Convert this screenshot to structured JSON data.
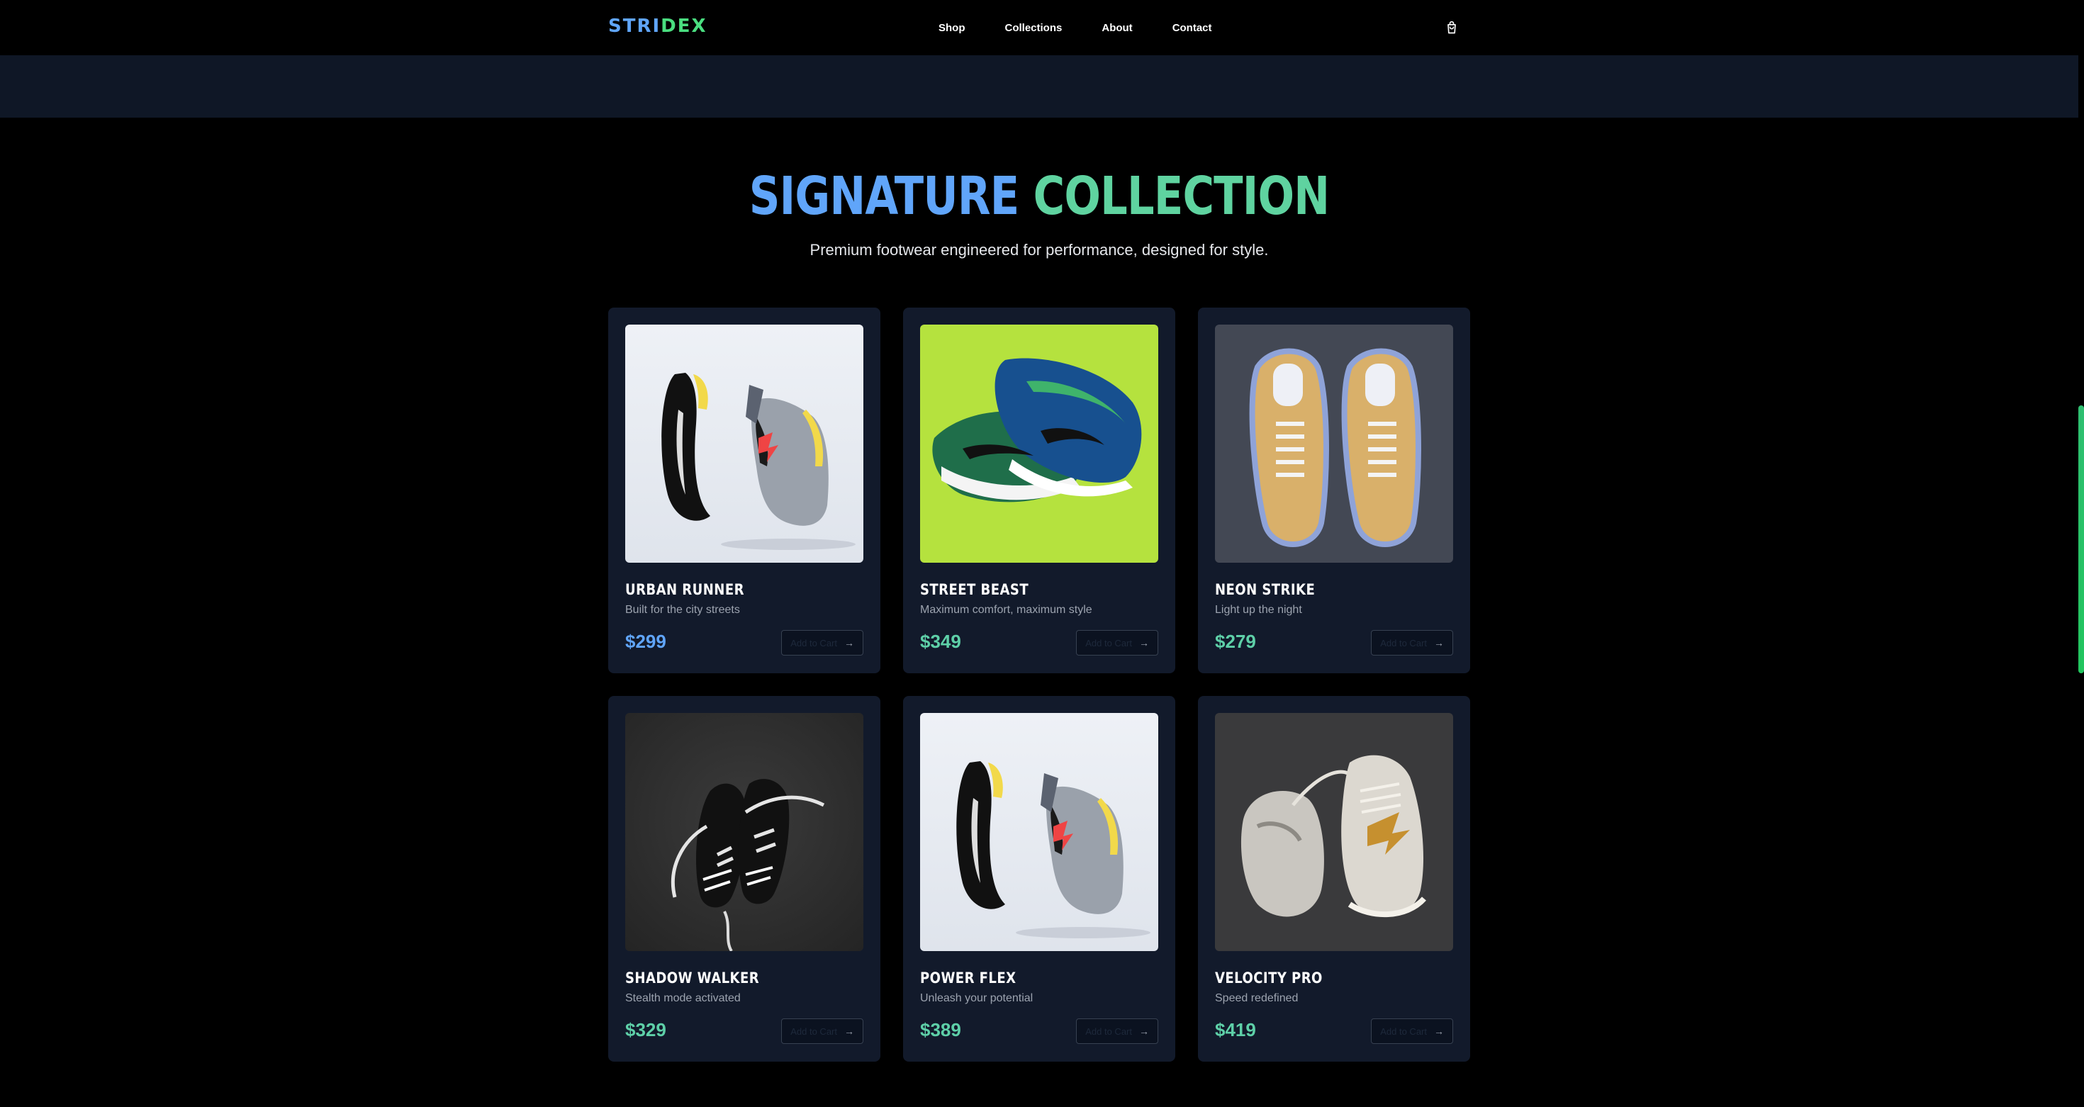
{
  "brand": {
    "logo_part1": "STRI",
    "logo_part2": "DEX"
  },
  "nav": {
    "links": [
      "Shop",
      "Collections",
      "About",
      "Contact"
    ]
  },
  "cart_icon": "shopping-bag-icon",
  "hero": {
    "title_part1": "SIGNATURE",
    "title_part2": "COLLECTION",
    "subtitle": "Premium footwear engineered for performance, designed for style."
  },
  "products": [
    {
      "name": "Urban Runner",
      "desc": "Built for the city streets",
      "price": "$299",
      "button": "Add to Cart"
    },
    {
      "name": "Street Beast",
      "desc": "Maximum comfort, maximum style",
      "price": "$349",
      "button": "Add to Cart"
    },
    {
      "name": "Neon Strike",
      "desc": "Light up the night",
      "price": "$279",
      "button": "Add to Cart"
    },
    {
      "name": "Shadow Walker",
      "desc": "Stealth mode activated",
      "price": "$329",
      "button": "Add to Cart"
    },
    {
      "name": "Power Flex",
      "desc": "Unleash your potential",
      "price": "$389",
      "button": "Add to Cart"
    },
    {
      "name": "Velocity Pro",
      "desc": "Speed redefined",
      "price": "$419",
      "button": "Add to Cart"
    }
  ],
  "colors": {
    "accent_blue": "#60a5fa",
    "accent_green": "#4ade80",
    "card_bg": "#121a2b",
    "page_bg": "#000000"
  }
}
